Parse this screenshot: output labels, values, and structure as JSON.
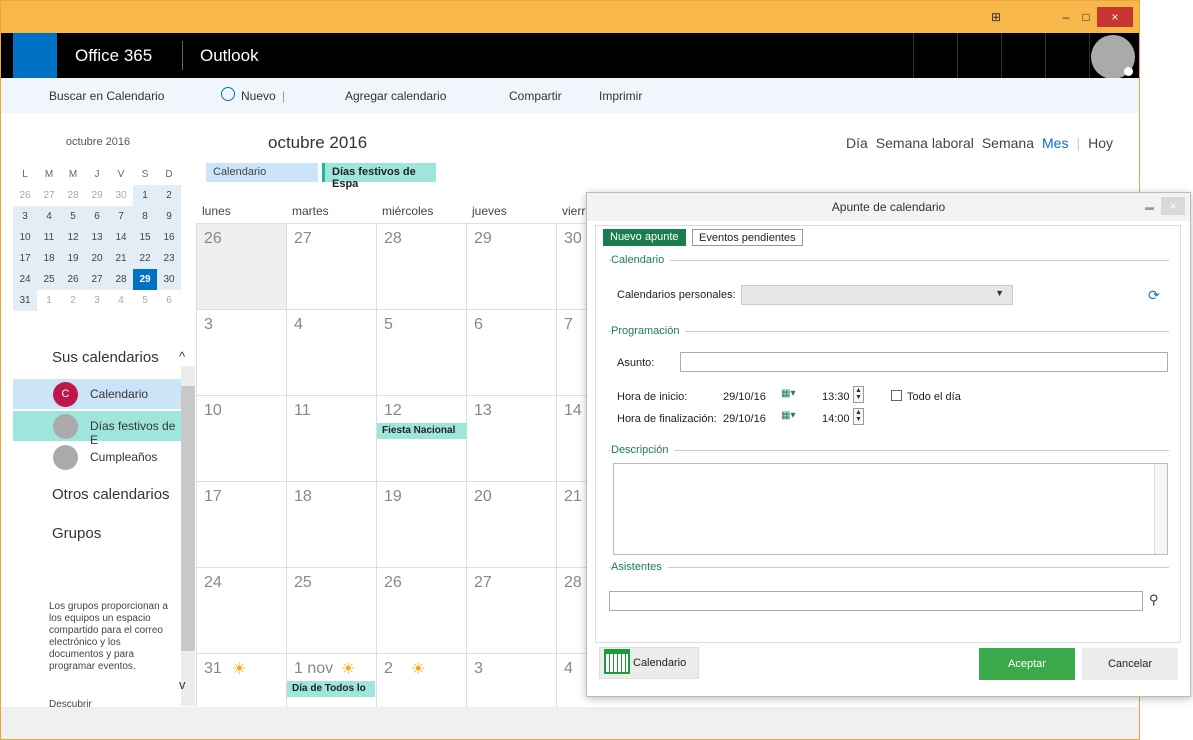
{
  "window": {
    "minimize": "–",
    "maximize": "□",
    "close": "×",
    "snap_icon": "window-icon"
  },
  "topbar": {
    "suite": "Office 365",
    "app": "Outlook"
  },
  "command": {
    "search": "Buscar en Calendario",
    "new": "Nuevo",
    "new_sep": "|",
    "add": "Agregar calendario",
    "share": "Compartir",
    "print": "Imprimir"
  },
  "sidebar": {
    "mini_title": "octubre 2016",
    "weekdays": [
      "L",
      "M",
      "M",
      "J",
      "V",
      "S",
      "D"
    ],
    "weeks": [
      [
        "26",
        "27",
        "28",
        "29",
        "30",
        "1",
        "2"
      ],
      [
        "3",
        "4",
        "5",
        "6",
        "7",
        "8",
        "9"
      ],
      [
        "10",
        "11",
        "12",
        "13",
        "14",
        "15",
        "16"
      ],
      [
        "17",
        "18",
        "19",
        "20",
        "21",
        "22",
        "23"
      ],
      [
        "24",
        "25",
        "26",
        "27",
        "28",
        "29",
        "30"
      ],
      [
        "31",
        "1",
        "2",
        "3",
        "4",
        "5",
        "6"
      ]
    ],
    "my_cals": "Sus calendarios",
    "cals": [
      {
        "label": "Calendario",
        "initial": "C",
        "color": "#c0174a"
      },
      {
        "label": "Días festivos de E",
        "initial": "",
        "color": "#aaaaaa"
      },
      {
        "label": "Cumpleaños",
        "initial": "",
        "color": "#aaaaaa"
      }
    ],
    "other": "Otros calendarios",
    "groups": "Grupos",
    "note": "Los grupos proporcionan a los equipos un espacio compartido para el correo electrónico y los documentos y para programar eventos.",
    "cut_label": "Descubrir"
  },
  "main": {
    "title": "octubre 2016",
    "views": [
      "Día",
      "Semana laboral",
      "Semana",
      "Mes",
      "Hoy"
    ],
    "active_view": "Mes",
    "tags": [
      "Calendario",
      "Días festivos de Espa"
    ],
    "days": [
      "lunes",
      "martes",
      "miércoles",
      "jueves",
      "vierr"
    ],
    "rows": [
      [
        "26",
        "27",
        "28",
        "29",
        "30"
      ],
      [
        "3",
        "4",
        "5",
        "6",
        "7"
      ],
      [
        "10",
        "11",
        "12",
        "13",
        "14"
      ],
      [
        "17",
        "18",
        "19",
        "20",
        "21"
      ],
      [
        "24",
        "25",
        "26",
        "27",
        "28"
      ],
      [
        "31",
        "1 nov",
        "2",
        "3",
        "4"
      ]
    ],
    "events": {
      "fiesta": "Fiesta Nacional",
      "todos": "Día de Todos lo"
    }
  },
  "dialog": {
    "title": "Apunte de calendario",
    "close": "×",
    "tabs": [
      "Nuevo apunte",
      "Eventos pendientes"
    ],
    "g_cal": "Calendario",
    "personal_label": "Calendarios personales:",
    "g_prog": "Programación",
    "subject_label": "Asunto:",
    "start_label": "Hora de inicio:",
    "start_date": "29/10/16",
    "start_time": "13:30",
    "allday": "Todo el día",
    "end_label": "Hora de finalización:",
    "end_date": "29/10/16",
    "end_time": "14:00",
    "g_desc": "Descripción",
    "g_att": "Asistentes",
    "cal_button": "Calendario",
    "ok": "Aceptar",
    "cancel": "Cancelar"
  }
}
